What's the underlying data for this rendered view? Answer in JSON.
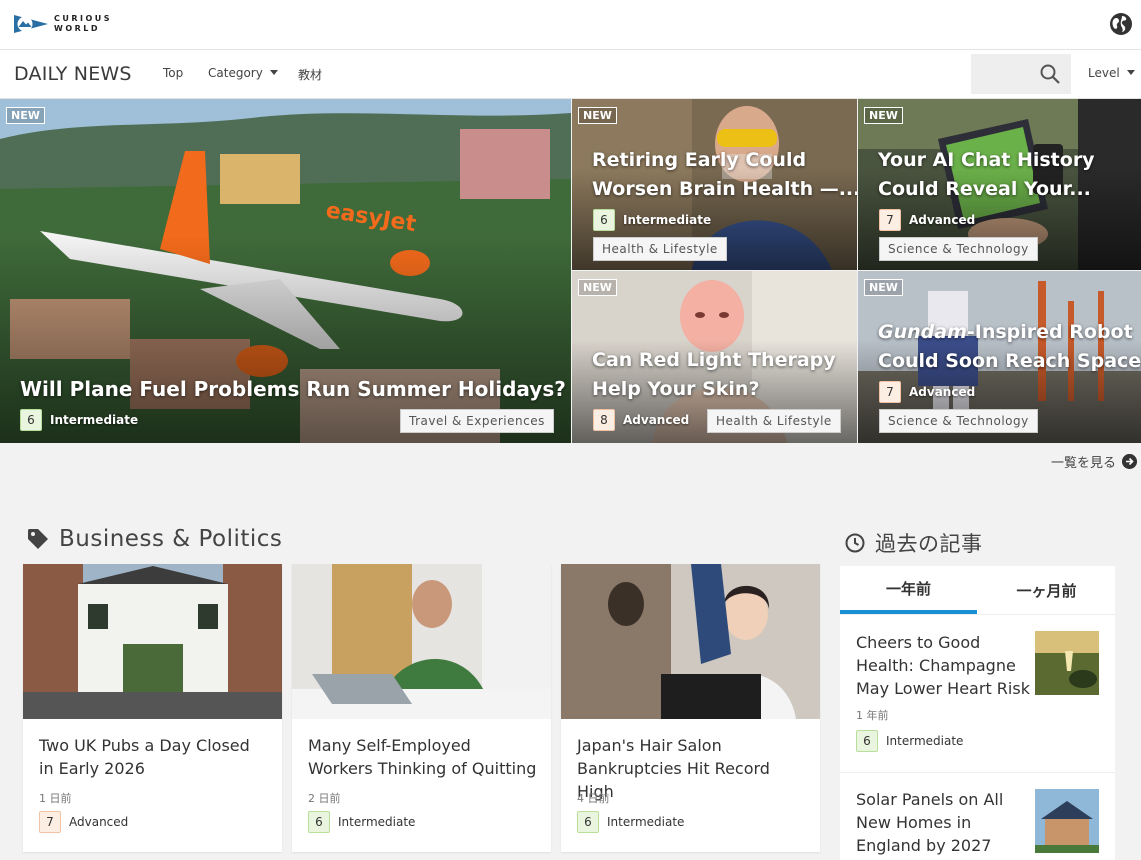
{
  "header": {
    "logo_line1": "CURIOUS",
    "logo_line2": "WORLD",
    "globe_icon": "globe-icon"
  },
  "nav": {
    "title": "DAILY NEWS",
    "top": "Top",
    "category": "Category",
    "kyozai": "教材",
    "search_icon": "search-icon",
    "level": "Level"
  },
  "hero": [
    {
      "badge": "NEW",
      "title": "Will Plane Fuel Problems Run Summer Holidays?",
      "level_num": "6",
      "level": "Intermediate",
      "category": "Travel & Experiences"
    },
    {
      "badge": "NEW",
      "title_l1": "Retiring Early Could",
      "title_l2": "Worsen Brain Health —...",
      "level_num": "6",
      "level": "Intermediate",
      "category": "Health & Lifestyle"
    },
    {
      "badge": "NEW",
      "title_l1": "Your AI Chat History",
      "title_l2": "Could Reveal Your...",
      "level_num": "7",
      "level": "Advanced",
      "category": "Science & Technology"
    },
    {
      "badge": "NEW",
      "title_l1": "Can Red Light Therapy",
      "title_l2": "Help Your Skin?",
      "level_num": "8",
      "level": "Advanced",
      "category": "Health & Lifestyle"
    },
    {
      "badge": "NEW",
      "title_italic": "Gundam",
      "title_l1_rest": "-Inspired Robot",
      "title_l2": "Could Soon Reach Space",
      "level_num": "7",
      "level": "Advanced",
      "category": "Science & Technology"
    }
  ],
  "see_all": "一覧を見る",
  "business": {
    "heading": "Business & Politics",
    "cards": [
      {
        "title": "Two UK Pubs a Day Closed in Early 2026",
        "time": "1 日前",
        "level_num": "7",
        "level": "Advanced"
      },
      {
        "title": "Many Self-Employed Workers Thinking of Quitting",
        "time": "2 日前",
        "level_num": "6",
        "level": "Intermediate"
      },
      {
        "title": "Japan's Hair Salon Bankruptcies Hit Record High",
        "time": "4 日前",
        "level_num": "6",
        "level": "Intermediate"
      }
    ]
  },
  "past": {
    "heading": "過去の記事",
    "tab1": "一年前",
    "tab2": "一ヶ月前",
    "items": [
      {
        "title": "Cheers to Good Health: Champagne May Lower Heart Risk",
        "time": "1 年前",
        "level_num": "6",
        "level": "Intermediate"
      },
      {
        "title": "Solar Panels on All New Homes in England by 2027"
      }
    ]
  }
}
